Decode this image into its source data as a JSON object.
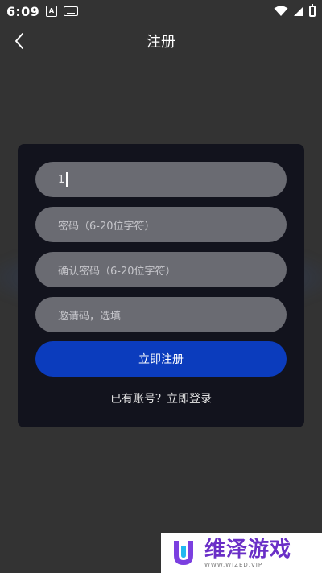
{
  "status_bar": {
    "time": "6:09",
    "notification_letter": "A"
  },
  "header": {
    "title": "注册"
  },
  "form": {
    "username_value": "1",
    "password_placeholder": "密码（6-20位字符）",
    "confirm_placeholder": "确认密码（6-20位字符）",
    "invite_placeholder": "邀请码，选填",
    "submit_label": "立即注册",
    "login_link": "已有账号？立即登录"
  },
  "watermark": {
    "name": "维泽游戏",
    "subtitle": "WWW.WIZED.VIP"
  },
  "colors": {
    "background": "#333333",
    "card": "#12131d",
    "field": "#6a6b72",
    "primary_button": "#0b3cbd",
    "watermark_brand": "#6a2fc7"
  }
}
